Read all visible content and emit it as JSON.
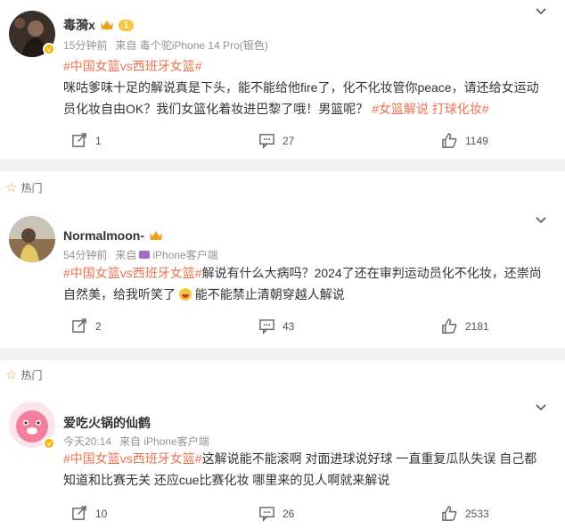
{
  "hot_label": "热门",
  "comments": [
    {
      "username": "毒漪x",
      "level": "1",
      "time": "15分钟前",
      "source": "来自 毒个驼iPhone 14 Pro(银色)",
      "topic": "#中国女篮vs西班牙女篮#",
      "text": "咪咕爹味十足的解说真是下头，能不能给他fire了，化不化妆管你peace，请还给女运动员化妆自由OK？我们女篮化着妆进巴黎了哦！男篮呢？",
      "tail_topics": "#女篮解说 打球化妆#",
      "share_count": "1",
      "comment_count": "27",
      "like_count": "1149"
    },
    {
      "username": "Normalmoon-",
      "time": "54分钟前",
      "source": "来自",
      "device": "iPhone客户端",
      "topic": "#中国女篮vs西班牙女篮#",
      "text": "解说有什么大病吗？2024了还在审判运动员化不化妆，还崇尚自然美，给我听笑了",
      "text_after": "能不能禁止清朝穿越人解说",
      "share_count": "2",
      "comment_count": "43",
      "like_count": "2181"
    },
    {
      "username": "爱吃火锅的仙鹤",
      "time": "今天20:14",
      "source": "来自 iPhone客户端",
      "topic": "#中国女篮vs西班牙女篮#",
      "text": "这解说能不能滚啊 对面进球说好球 一直重复瓜队失误 自己都知道和比赛无关 还应cue比赛化妆 哪里来的见人啊就来解说",
      "share_count": "10",
      "comment_count": "26",
      "like_count": "2533"
    }
  ]
}
